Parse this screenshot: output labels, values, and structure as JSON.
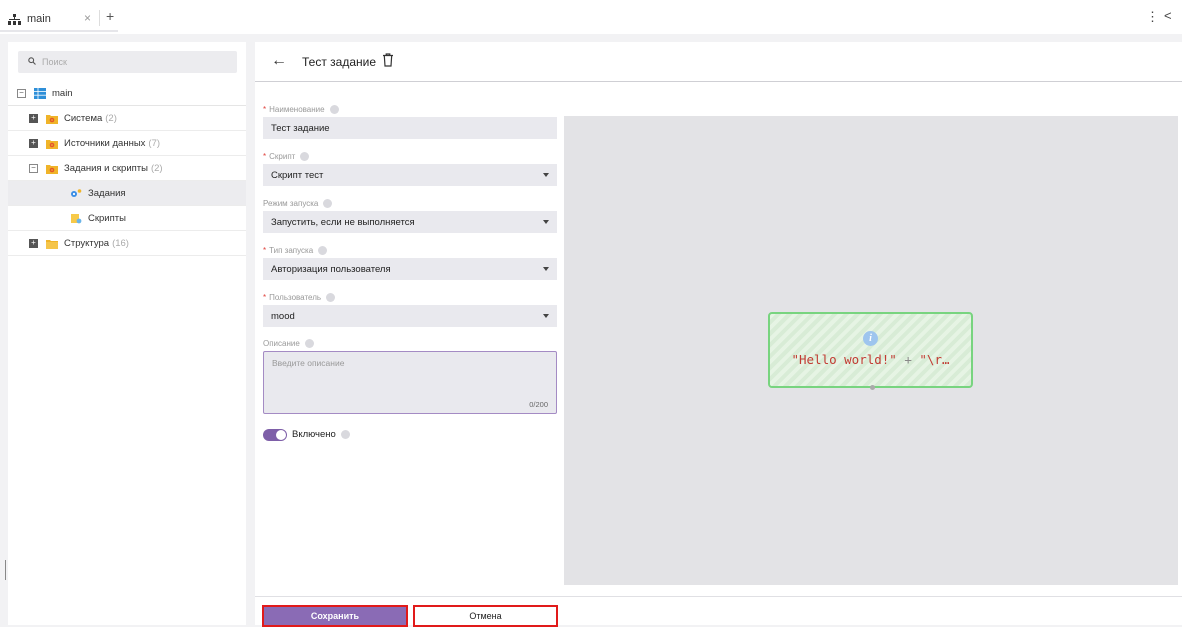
{
  "tabs": {
    "active_label": "main",
    "close_glyph": "×",
    "add_glyph": "+"
  },
  "window_controls": {
    "menu_glyph": "⋮",
    "collapse_glyph": "<"
  },
  "search": {
    "placeholder": "Поиск",
    "icon": "search-icon"
  },
  "tree": {
    "root": {
      "label": "main",
      "icon": "table-icon"
    },
    "items": [
      {
        "label": "Система",
        "count": "(2)",
        "icon": "folder-gear-icon"
      },
      {
        "label": "Источники данных",
        "count": "(7)",
        "icon": "folder-gear-icon"
      },
      {
        "label": "Задания и скрипты",
        "count": "(2)",
        "icon": "folder-gear-icon"
      },
      {
        "label": "Задания",
        "count": "",
        "icon": "tasks-icon",
        "active": true
      },
      {
        "label": "Скрипты",
        "count": "",
        "icon": "scripts-icon"
      },
      {
        "label": "Структура",
        "count": "(16)",
        "icon": "folder-icon"
      }
    ]
  },
  "header": {
    "back_glyph": "←",
    "title": "Тест задание"
  },
  "form": {
    "name": {
      "label": "Наименование",
      "required": "*",
      "value": "Тест задание"
    },
    "script": {
      "label": "Скрипт",
      "required": "*",
      "value": "Скрипт тест"
    },
    "run_mode": {
      "label": "Режим запуска",
      "value": "Запустить, если не выполняется"
    },
    "run_type": {
      "label": "Тип запуска",
      "required": "*",
      "value": "Авторизация пользователя"
    },
    "user": {
      "label": "Пользователь",
      "required": "*",
      "value": "mood"
    },
    "description": {
      "label": "Описание",
      "placeholder": "Введите описание",
      "counter": "0/200"
    },
    "enabled": {
      "label": "Включено",
      "on": true
    }
  },
  "canvas": {
    "node_code_string": "\"Hello world!\"",
    "node_code_plus": " + ",
    "node_code_rest": "\"\\r…",
    "info_glyph": "i"
  },
  "footer": {
    "save_label": "Сохранить",
    "cancel_label": "Отмена"
  },
  "colors": {
    "accent": "#8a6bb5",
    "required": "#e0433d",
    "highlight_border": "#e11a1a",
    "node_border": "#78d47f",
    "code_text": "#c23b33"
  }
}
